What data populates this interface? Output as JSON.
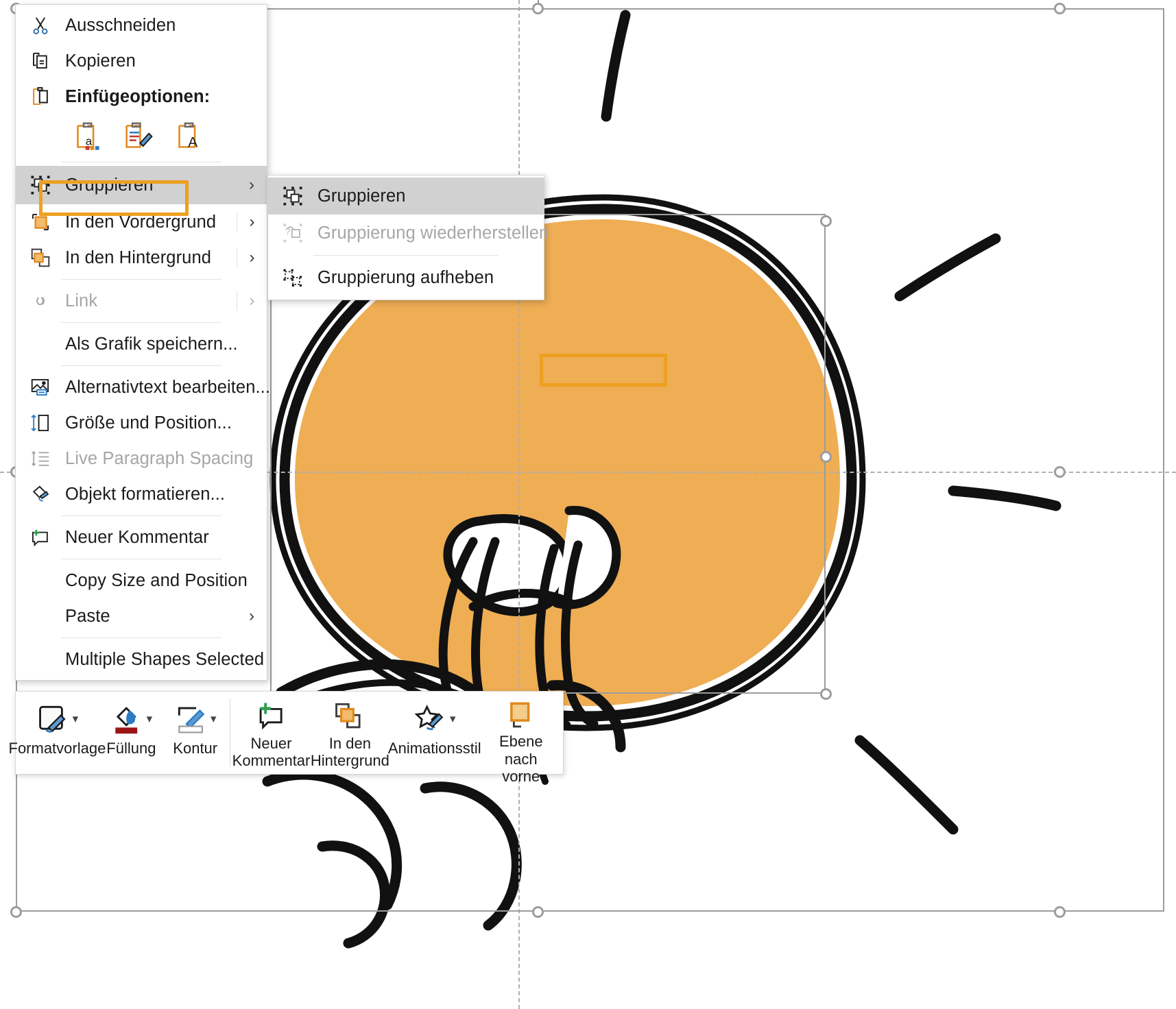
{
  "app": {
    "surface": "powerpoint-slide-canvas",
    "selection_status": "Multiple Shapes Selected"
  },
  "context_menu": {
    "items": [
      {
        "id": "cut",
        "label": "Ausschneiden",
        "icon": "scissors-icon",
        "state": "enabled",
        "submenu": false
      },
      {
        "id": "copy",
        "label": "Kopieren",
        "icon": "copy-icon",
        "state": "enabled",
        "submenu": false
      },
      {
        "id": "paste_options",
        "label": "Einfügeoptionen:",
        "icon": "clipboard-icon",
        "state": "header",
        "submenu": false
      },
      {
        "id": "group",
        "label": "Gruppieren",
        "icon": "group-icon",
        "state": "selected",
        "submenu": true
      },
      {
        "id": "bring_to_front",
        "label": "In den Vordergrund",
        "icon": "bring-to-front-icon",
        "state": "enabled",
        "submenu": true
      },
      {
        "id": "send_to_back",
        "label": "In den Hintergrund",
        "icon": "send-to-back-icon",
        "state": "enabled",
        "submenu": true
      },
      {
        "id": "link",
        "label": "Link",
        "icon": "link-icon",
        "state": "disabled",
        "submenu": true
      },
      {
        "id": "save_as_picture",
        "label": "Als Grafik speichern...",
        "icon": "none",
        "state": "enabled",
        "submenu": false
      },
      {
        "id": "edit_alt_text",
        "label": "Alternativtext bearbeiten...",
        "icon": "alt-text-icon",
        "state": "enabled",
        "submenu": false
      },
      {
        "id": "size_and_position",
        "label": "Größe und Position...",
        "icon": "size-position-icon",
        "state": "enabled",
        "submenu": false
      },
      {
        "id": "live_paragraph_spacing",
        "label": "Live Paragraph Spacing",
        "icon": "line-spacing-icon",
        "state": "disabled",
        "submenu": false
      },
      {
        "id": "format_object",
        "label": "Objekt formatieren...",
        "icon": "format-object-icon",
        "state": "enabled",
        "submenu": false
      },
      {
        "id": "new_comment",
        "label": "Neuer Kommentar",
        "icon": "new-comment-icon",
        "state": "enabled",
        "submenu": false
      },
      {
        "id": "copy_size_and_position",
        "label": "Copy Size and Position",
        "icon": "none",
        "state": "enabled",
        "submenu": false
      },
      {
        "id": "paste",
        "label": "Paste",
        "icon": "none",
        "state": "enabled",
        "submenu": true
      },
      {
        "id": "multiple_shapes_selected",
        "label": "Multiple Shapes Selected",
        "icon": "none",
        "state": "enabled",
        "submenu": false
      }
    ],
    "paste_option_icons": [
      {
        "id": "keep_source_formatting",
        "name": "paste-keep-source-formatting-icon"
      },
      {
        "id": "use_destination_theme",
        "name": "paste-use-destination-theme-icon"
      },
      {
        "id": "keep_text_only",
        "name": "paste-keep-text-only-icon"
      }
    ]
  },
  "group_submenu": {
    "items": [
      {
        "id": "group",
        "label": "Gruppieren",
        "icon": "group-icon",
        "state": "selected"
      },
      {
        "id": "regroup",
        "label": "Gruppierung wiederherstellen",
        "icon": "regroup-icon",
        "state": "disabled"
      },
      {
        "id": "ungroup",
        "label": "Gruppierung aufheben",
        "icon": "ungroup-icon",
        "state": "enabled"
      }
    ]
  },
  "mini_toolbar": {
    "items": [
      {
        "id": "format_style",
        "label": "Formatvorlage",
        "icon": "shape-style-icon",
        "dropdown": true
      },
      {
        "id": "fill",
        "label": "Füllung",
        "icon": "fill-bucket-icon",
        "dropdown": true,
        "color": "#9c1316"
      },
      {
        "id": "outline",
        "label": "Kontur",
        "icon": "shape-outline-icon",
        "dropdown": true,
        "color": "#ffffff"
      },
      {
        "id": "new_comment",
        "label": "Neuer\nKommentar",
        "icon": "new-comment-icon",
        "dropdown": false
      },
      {
        "id": "send_to_back",
        "label": "In den\nHintergrund",
        "icon": "send-to-back-icon",
        "dropdown": false
      },
      {
        "id": "animation_style",
        "label": "Animationsstil",
        "icon": "animation-style-icon",
        "dropdown": true
      },
      {
        "id": "bring_layer_forward",
        "label": "Ebene nach\nvorne",
        "icon": "bring-forward-icon",
        "dropdown": false
      }
    ]
  },
  "colors": {
    "highlight_annotation": "#eda020",
    "artwork_fill": "#efad54",
    "selection_handle": "#9c9c9c",
    "menu_selected_bg": "#d1d1d1",
    "fill_swatch": "#9c1316"
  },
  "canvas": {
    "artwork_name": "hand-drawn-character-illustration",
    "selection_handles": 8,
    "guides": {
      "vertical": 1,
      "horizontal": 1
    }
  }
}
